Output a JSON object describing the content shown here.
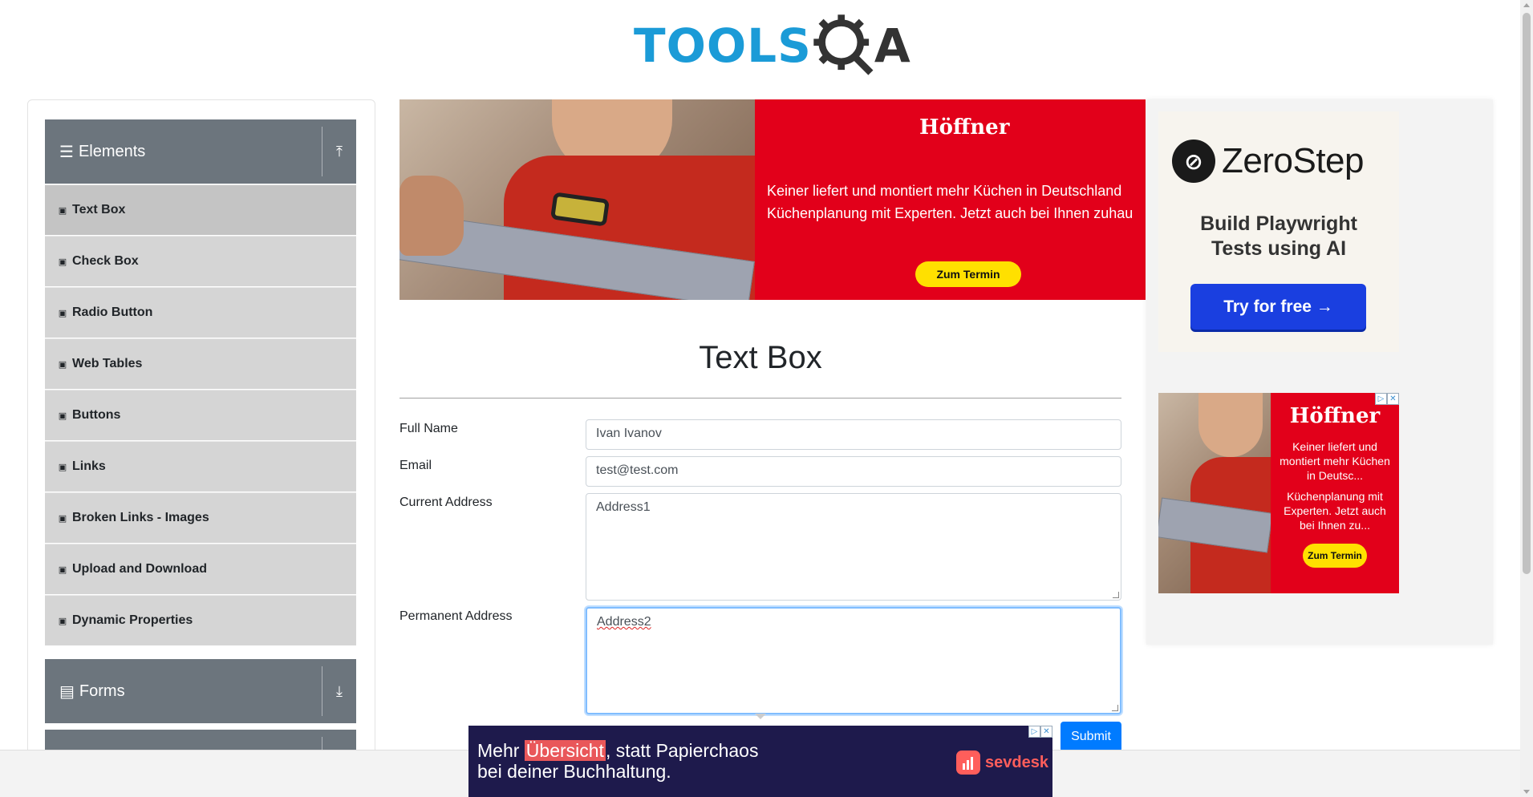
{
  "header": {
    "logo_left": "TOOLS",
    "logo_right": "A"
  },
  "sidebar": {
    "group_elements": {
      "label": "Elements",
      "icon": "hamburger-icon",
      "toggle_icon": "collapse-up-icon"
    },
    "items": [
      {
        "label": "Text Box",
        "icon": "html5-icon",
        "active": true
      },
      {
        "label": "Check Box",
        "icon": "html5-icon"
      },
      {
        "label": "Radio Button",
        "icon": "html5-icon"
      },
      {
        "label": "Web Tables",
        "icon": "html5-icon"
      },
      {
        "label": "Buttons",
        "icon": "html5-icon"
      },
      {
        "label": "Links",
        "icon": "html5-icon"
      },
      {
        "label": "Broken Links - Images",
        "icon": "html5-icon"
      },
      {
        "label": "Upload and Download",
        "icon": "html5-icon"
      },
      {
        "label": "Dynamic Properties",
        "icon": "html5-icon"
      }
    ],
    "group_forms": {
      "label": "Forms",
      "icon": "document-icon",
      "toggle_icon": "expand-down-icon"
    }
  },
  "banner_ad": {
    "brand": "Höffner",
    "line1": "Keiner liefert und montiert mehr Küchen in Deutschland",
    "line2": "Küchenplanung mit Experten. Jetzt auch bei Ihnen zuhau",
    "cta": "Zum Termin",
    "brand_color": "#e2001a"
  },
  "page": {
    "title": "Text Box"
  },
  "form": {
    "full_name": {
      "label": "Full Name",
      "value": "Ivan Ivanov"
    },
    "email": {
      "label": "Email",
      "value": "test@test.com"
    },
    "current_address": {
      "label": "Current Address",
      "value": "Address1"
    },
    "permanent_address": {
      "label": "Permanent Address",
      "value": "Address2"
    },
    "submit_label": "Submit",
    "submit_color": "#007bff"
  },
  "side_ad_zerostep": {
    "brand": "ZeroStep",
    "tagline_line1": "Build Playwright",
    "tagline_line2": "Tests using AI",
    "cta": "Try for free →",
    "cta_color": "#1a3fe0"
  },
  "side_ad_hoffner": {
    "brand": "Höffner",
    "text1": "Keiner liefert und montiert mehr Küchen in Deutsc...",
    "text2": "Küchenplanung mit Experten. Jetzt auch bei Ihnen zu...",
    "cta": "Zum Termin"
  },
  "sticky_ad": {
    "line1_pre": "Mehr ",
    "line1_highlight": "Übersicht",
    "line1_post": ", statt Papierchaos",
    "line2": "bei deiner Buchhaltung.",
    "brand": "sevdesk",
    "brand_color": "#ff5e5b"
  },
  "adchoices": {
    "info": "▷",
    "close": "✕"
  }
}
